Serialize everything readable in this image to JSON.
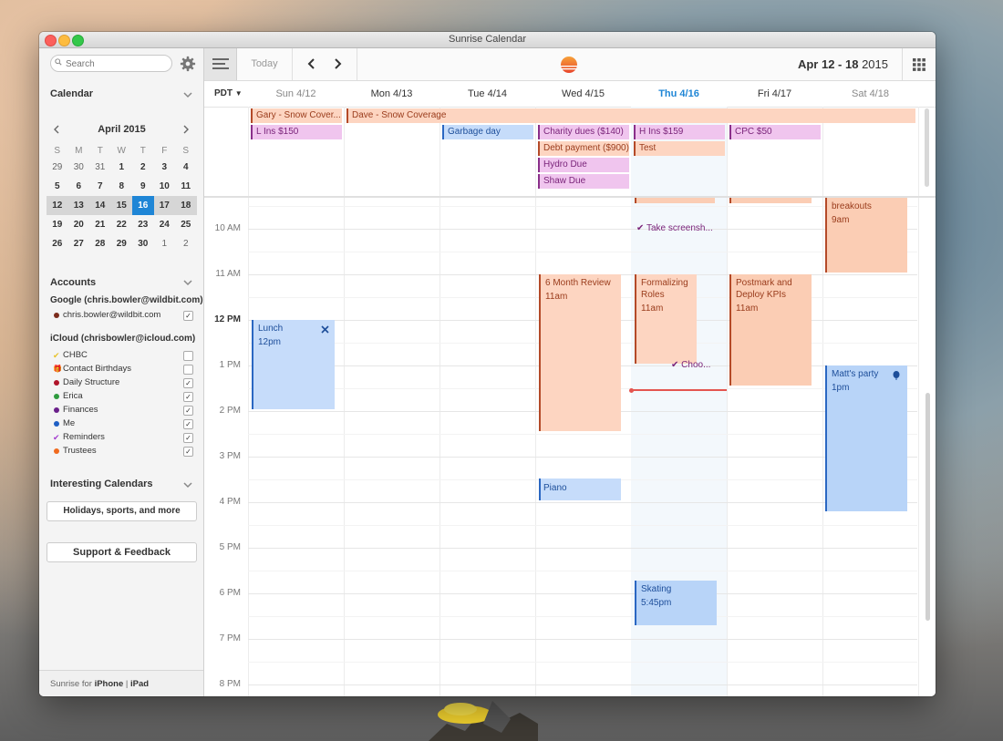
{
  "window": {
    "title": "Sunrise Calendar"
  },
  "sidebar": {
    "search_placeholder": "Search",
    "calendar_section": "Calendar",
    "minical": {
      "month": "April 2015",
      "dow": [
        "S",
        "M",
        "T",
        "W",
        "T",
        "F",
        "S"
      ],
      "weeks": [
        [
          "29",
          "30",
          "31",
          "1",
          "2",
          "3",
          "4"
        ],
        [
          "5",
          "6",
          "7",
          "8",
          "9",
          "10",
          "11"
        ],
        [
          "12",
          "13",
          "14",
          "15",
          "16",
          "17",
          "18"
        ],
        [
          "19",
          "20",
          "21",
          "22",
          "23",
          "24",
          "25"
        ],
        [
          "26",
          "27",
          "28",
          "29",
          "30",
          "1",
          "2"
        ]
      ],
      "today": "16"
    },
    "accounts_section": "Accounts",
    "google_account": "Google (chris.bowler@wildbit.com)",
    "google_calendars": [
      {
        "label": "chris.bowler@wildbit.com",
        "color": "#7b2c1c",
        "checked": true
      }
    ],
    "icloud_account": "iCloud (chrisbowler@icloud.com)",
    "icloud_calendars": [
      {
        "label": "CHBC",
        "color": "#e8c32a",
        "checked": false,
        "icon": "check-mark-icon"
      },
      {
        "label": "Contact Birthdays",
        "color": "#888888",
        "checked": false,
        "icon": "gift-icon"
      },
      {
        "label": "Daily Structure",
        "color": "#b0142a",
        "checked": true
      },
      {
        "label": "Erica",
        "color": "#2e9b3e",
        "checked": true
      },
      {
        "label": "Finances",
        "color": "#6a1f8a",
        "checked": true
      },
      {
        "label": "Me",
        "color": "#1f5fc4",
        "checked": true
      },
      {
        "label": "Reminders",
        "color": "#a33ccf",
        "checked": true,
        "icon": "check-mark-icon"
      },
      {
        "label": "Trustees",
        "color": "#f06a1e",
        "checked": true
      }
    ],
    "interesting_section": "Interesting Calendars",
    "holidays_button": "Holidays, sports, and more",
    "support_button": "Support & Feedback",
    "footer": {
      "prefix": "Sunrise for",
      "iphone": "iPhone",
      "sep": "|",
      "ipad": "iPad"
    }
  },
  "toolbar": {
    "today": "Today",
    "range_bold": "Apr 12 - 18",
    "range_year": "2015"
  },
  "header": {
    "timezone": "PDT",
    "days": [
      "Sun 4/12",
      "Mon 4/13",
      "Tue 4/14",
      "Wed 4/15",
      "Thu 4/16",
      "Fri 4/17",
      "Sat 4/18"
    ],
    "today_index": 4
  },
  "allday_events": [
    {
      "label": "Gary - Snow Cover...",
      "color": "orange"
    },
    {
      "label": "Dave - Snow Coverage",
      "color": "orange"
    },
    {
      "label": "L Ins $150",
      "color": "pink"
    },
    {
      "label": "Garbage day",
      "color": "blue"
    },
    {
      "label": "Charity dues ($140)",
      "color": "pink"
    },
    {
      "label": "Debt payment ($900)",
      "color": "orange"
    },
    {
      "label": "Hydro Due",
      "color": "pink"
    },
    {
      "label": "Shaw Due",
      "color": "pink"
    },
    {
      "label": "H Ins $159",
      "color": "pink"
    },
    {
      "label": "Test",
      "color": "orange"
    },
    {
      "label": "CPC $50",
      "color": "pink"
    }
  ],
  "hours": [
    "10 AM",
    "11 AM",
    "12 PM",
    "1 PM",
    "2 PM",
    "3 PM",
    "4 PM",
    "5 PM",
    "6 PM",
    "7 PM",
    "8 PM"
  ],
  "timed_events": {
    "breakouts": {
      "title": "breakouts",
      "time": "9am"
    },
    "take_screenshot": {
      "title": "Take screensh..."
    },
    "six_month": {
      "title": "6 Month Review",
      "time": "11am"
    },
    "formalizing": {
      "title": "Formalizing Roles",
      "time": "11am"
    },
    "postmark": {
      "title": "Postmark and Deploy KPIs",
      "time": "11am"
    },
    "lunch": {
      "title": "Lunch",
      "time": "12pm"
    },
    "choo": {
      "title": "Choo..."
    },
    "matts_party": {
      "title": "Matt's party",
      "time": "1pm"
    },
    "piano": {
      "title": "Piano"
    },
    "skating": {
      "title": "Skating",
      "time": "5:45pm"
    }
  }
}
